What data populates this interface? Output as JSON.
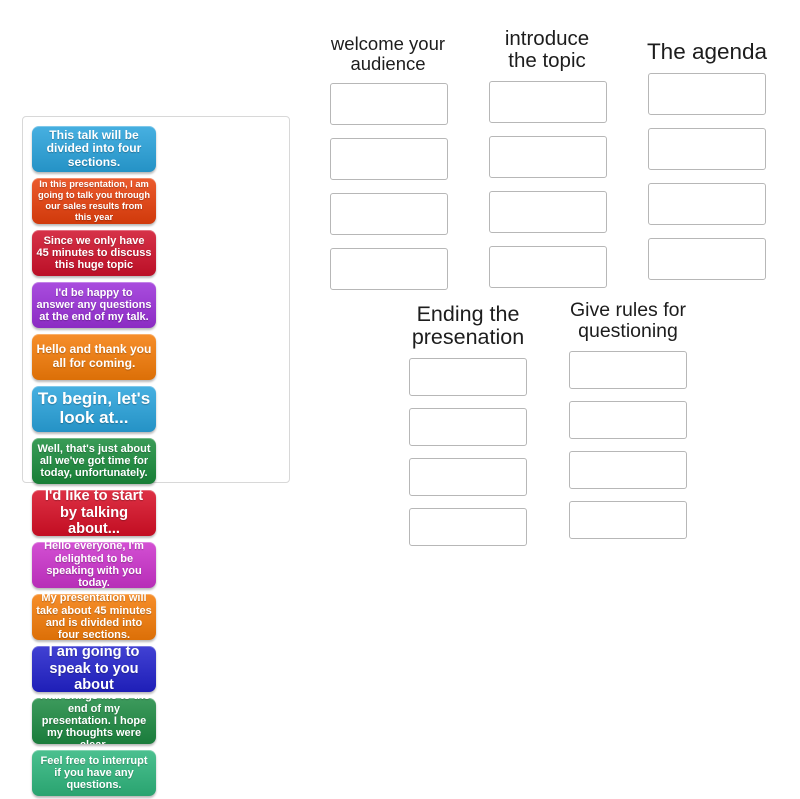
{
  "tray": {
    "name": "answer-tiles-tray",
    "tiles": [
      {
        "text": "This talk will be divided into four sections.",
        "color": "#29a3dc",
        "size": "fs-m"
      },
      {
        "text": "In this presentation, I am going to talk you through our sales results from this year",
        "color": "#e8400c",
        "size": "fs-xs"
      },
      {
        "text": "Since we only have 45 minutes to discuss this huge topic",
        "color": "#d0112b",
        "size": "fs-s"
      },
      {
        "text": "I'd be happy to answer any questions at the end of my talk.",
        "color": "#9b30d9",
        "size": "fs-s"
      },
      {
        "text": "Hello and thank you all for coming.",
        "color": "#f57c08",
        "size": "fs-m"
      },
      {
        "text": "To begin, let's look at...",
        "color": "#29a3dc",
        "size": "fs-xl"
      },
      {
        "text": "Well, that's just about all we've got time for today, unfortunately.",
        "color": "#1a8c3c",
        "size": "fs-s"
      },
      {
        "text": "I'd like to start by talking about...",
        "color": "#d80f26",
        "size": "fs-l"
      },
      {
        "text": "Hello everyone, I'm delighted to be speaking with you today.",
        "color": "#cc33cc",
        "size": "fs-s"
      },
      {
        "text": "My presentation will take about 45 minutes and is divided into four sections.",
        "color": "#f57c08",
        "size": "fs-s"
      },
      {
        "text": "I am going to speak to you about",
        "color": "#2222cc",
        "size": "fs-l"
      },
      {
        "text": "That brings me to the end of my presentation. I hope my thoughts were clear.",
        "color": "#1d8a42",
        "size": "fs-s"
      },
      {
        "text": "Feel free to interrupt if you have any questions.",
        "color": "#2eb67d",
        "size": "fs-s"
      }
    ]
  },
  "groups": [
    {
      "id": "welcome",
      "title": "welcome your\naudience",
      "slots": 4
    },
    {
      "id": "introduce",
      "title": "introduce\nthe topic",
      "slots": 4
    },
    {
      "id": "agenda",
      "title": "The agenda",
      "slots": 4
    },
    {
      "id": "ending",
      "title": "Ending the\npresenation",
      "slots": 4
    },
    {
      "id": "questions",
      "title": "Give rules for\nquestioning",
      "slots": 4
    }
  ],
  "colors": {
    "slot_border": "#b7b7b7",
    "tray_border": "#d8d8d8",
    "title_text": "#1d1d1d",
    "background": "#ffffff"
  }
}
